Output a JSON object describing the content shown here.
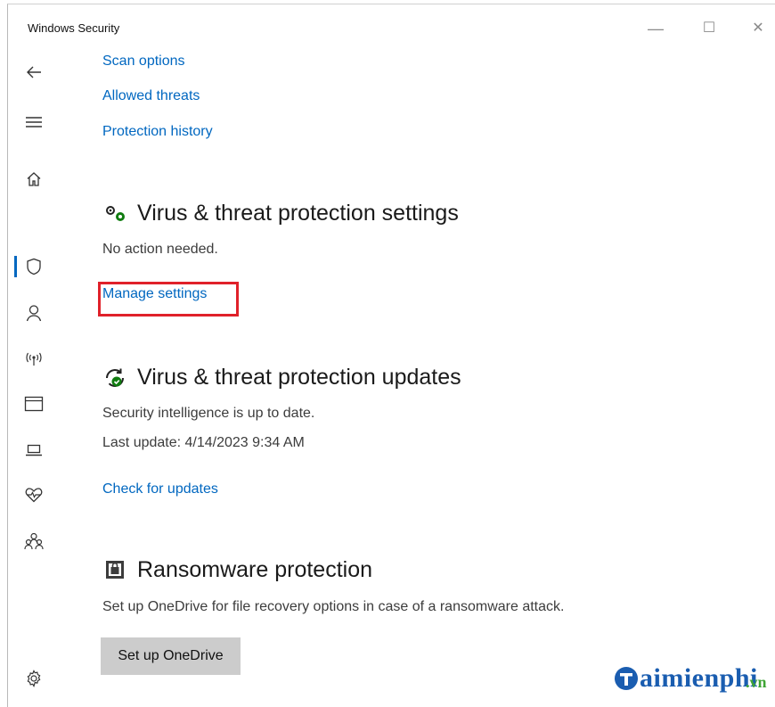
{
  "window": {
    "title": "Windows Security",
    "controls": {
      "minimize": "—",
      "maximize": "☐",
      "close": "✕"
    }
  },
  "sidebar": {
    "items": [
      {
        "name": "back",
        "icon": "back-arrow-icon"
      },
      {
        "name": "menu",
        "icon": "hamburger-icon"
      },
      {
        "name": "home",
        "icon": "home-icon"
      },
      {
        "name": "virus-protection",
        "icon": "shield-icon",
        "selected": true
      },
      {
        "name": "account",
        "icon": "person-icon"
      },
      {
        "name": "firewall",
        "icon": "antenna-icon"
      },
      {
        "name": "app-browser",
        "icon": "browser-window-icon"
      },
      {
        "name": "device-security",
        "icon": "laptop-icon"
      },
      {
        "name": "device-health",
        "icon": "heart-pulse-icon"
      },
      {
        "name": "family",
        "icon": "family-icon"
      },
      {
        "name": "settings",
        "icon": "gear-icon"
      }
    ],
    "accent": "#0067c0"
  },
  "links": {
    "scan_options": "Scan options",
    "allowed_threats": "Allowed threats",
    "protection_history": "Protection history"
  },
  "settings_section": {
    "title": "Virus & threat protection settings",
    "status": "No action needed.",
    "link": "Manage settings",
    "highlight_color": "#e0212a"
  },
  "updates_section": {
    "title": "Virus & threat protection updates",
    "status": "Security intelligence is up to date.",
    "last_update": "Last update: 4/14/2023 9:34 AM",
    "link": "Check for updates"
  },
  "ransomware_section": {
    "title": "Ransomware protection",
    "description": "Set up OneDrive for file recovery options in case of a ransomware attack.",
    "button": "Set up OneDrive"
  },
  "watermark": {
    "text": "aimienphi",
    "suffix": ".vn"
  }
}
